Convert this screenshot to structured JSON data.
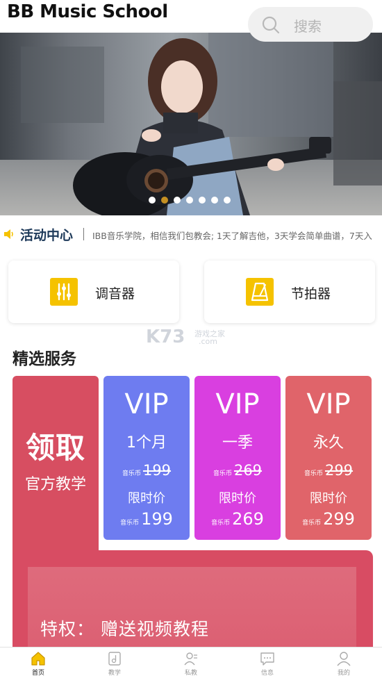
{
  "header": {
    "title": "BB Music School"
  },
  "search": {
    "label": "搜索",
    "icon": "search-icon"
  },
  "banner": {
    "slides": 7,
    "active_slide": 2
  },
  "activity": {
    "title": "活动中心",
    "text": "IBB音乐学院，相信我们包教会; 1天了解吉他，3天学会简单曲谱，7天入"
  },
  "tools": [
    {
      "label": "调音器",
      "icon": "tuner-icon"
    },
    {
      "label": "节拍器",
      "icon": "metronome-icon"
    }
  ],
  "watermark": {
    "brand": "K73",
    "cn": "游戏之家",
    "domain": ".com"
  },
  "services": {
    "section_title": "精选服务",
    "claim": {
      "main": "领取",
      "sub": "官方教学"
    },
    "vip_cards": [
      {
        "title": "VIP",
        "period": "1个月",
        "coin": "音乐币",
        "old_price": "199",
        "tag": "限时价",
        "new_price": "199",
        "color": "#6e7cf0"
      },
      {
        "title": "VIP",
        "period": "一季",
        "coin": "音乐币",
        "old_price": "269",
        "tag": "限时价",
        "new_price": "269",
        "color": "#d93fe0"
      },
      {
        "title": "VIP",
        "period": "永久",
        "coin": "音乐币",
        "old_price": "299",
        "tag": "限时价",
        "new_price": "299",
        "color": "#e0646a"
      }
    ],
    "privilege": "特权：  赠送视频教程"
  },
  "nav": {
    "items": [
      {
        "label": "首页",
        "icon": "home-icon",
        "active": true
      },
      {
        "label": "教学",
        "icon": "teaching-icon",
        "active": false
      },
      {
        "label": "私教",
        "icon": "private-tutor-icon",
        "active": false
      },
      {
        "label": "信息",
        "icon": "message-icon",
        "active": false
      },
      {
        "label": "我的",
        "icon": "profile-icon",
        "active": false
      }
    ]
  },
  "colors": {
    "accent": "#f5c200",
    "claim": "#d74e61",
    "privilege": "#d84c63",
    "dot_active": "#c59022"
  }
}
